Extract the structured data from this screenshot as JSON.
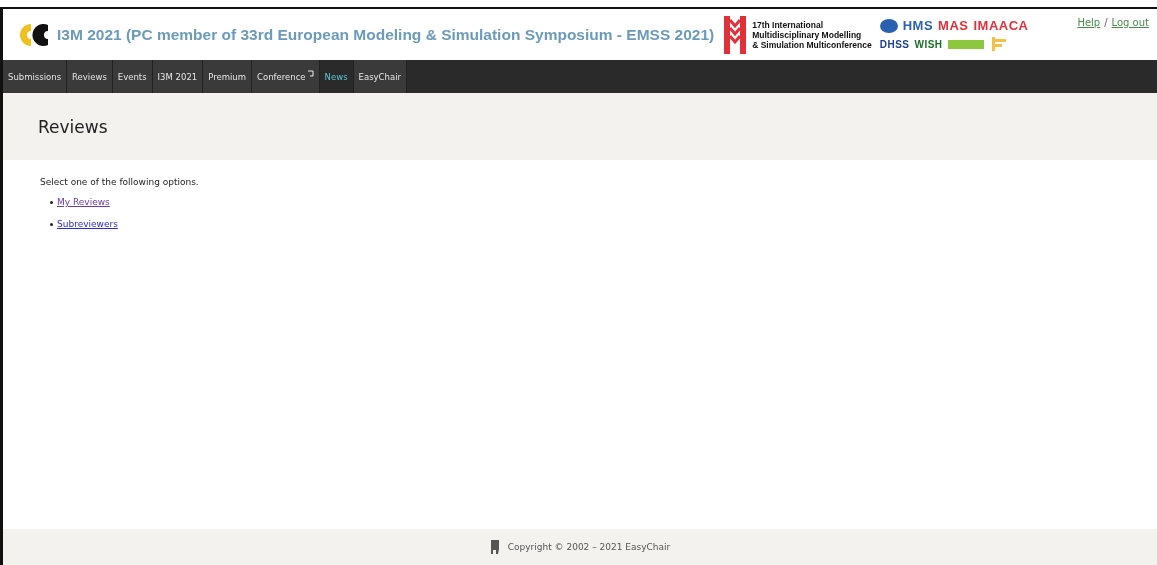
{
  "header": {
    "title": "I3M 2021 (PC member of 33rd European Modeling & Simulation Symposium - EMSS 2021)",
    "conference_logo": {
      "lines": [
        "17th International",
        "Multidisciplinary Modelling",
        "& Simulation Multiconference"
      ]
    },
    "partner_logos": {
      "top": [
        {
          "label": "HMS",
          "color": "#2b5fb0"
        },
        {
          "label": "MAS",
          "color": "#e0313a"
        },
        {
          "label": "IMAACA",
          "color": "#e0313a"
        }
      ],
      "bottom": [
        {
          "label": "DHSS",
          "color": "#1d3f8a"
        },
        {
          "label": "WISH",
          "color": "#1a6e2a"
        }
      ]
    },
    "links": [
      "Help",
      "Log out"
    ],
    "link_separator": "/"
  },
  "nav": [
    {
      "label": "Submissions",
      "highlighted": false,
      "external": false
    },
    {
      "label": "Reviews",
      "highlighted": false,
      "external": false
    },
    {
      "label": "Events",
      "highlighted": false,
      "external": false
    },
    {
      "label": "I3M 2021",
      "highlighted": false,
      "external": false
    },
    {
      "label": "Premium",
      "highlighted": false,
      "external": false
    },
    {
      "label": "Conference",
      "highlighted": false,
      "external": true
    },
    {
      "label": "News",
      "highlighted": true,
      "external": false
    },
    {
      "label": "EasyChair",
      "highlighted": false,
      "external": false
    }
  ],
  "page_title": "Reviews",
  "intro": "Select one of the following options.",
  "options": [
    {
      "label": "My Reviews",
      "visited": true
    },
    {
      "label": "Subreviewers",
      "visited": false
    }
  ],
  "footer": "Copyright © 2002 – 2021 EasyChair"
}
